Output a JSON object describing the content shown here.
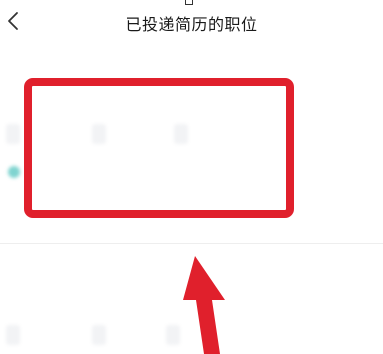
{
  "header": {
    "title": "已投递简历的职位"
  },
  "jobs": [
    {
      "title": "",
      "salary": "",
      "meta": "",
      "tags": [
        "",
        "",
        ""
      ],
      "recruiter": "",
      "status": "",
      "extra": ""
    },
    {
      "title": "",
      "salary": "",
      "meta": "",
      "tags": [
        "",
        "",
        ""
      ],
      "recruiter": "",
      "status": "",
      "extra": ""
    }
  ],
  "annotation": {
    "color": "#e0202c"
  },
  "colors": {
    "salary": "#3ec8c0",
    "tag_bg": "#f2f3f5"
  }
}
